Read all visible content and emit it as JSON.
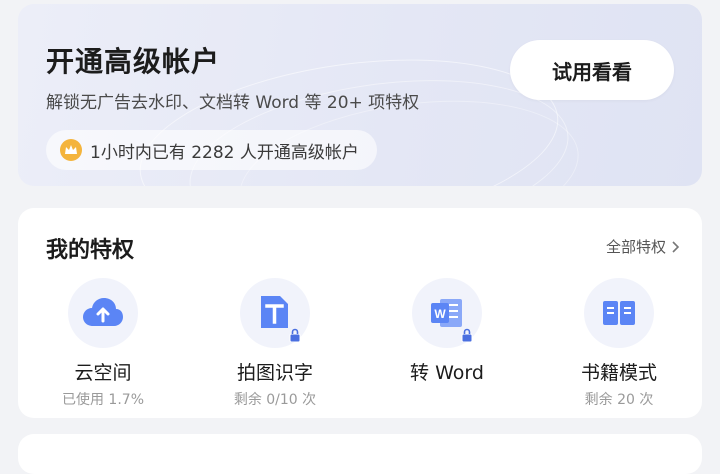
{
  "banner": {
    "title": "开通高级帐户",
    "subtitle": "解锁无广告去水印、文档转 Word 等 20+ 项特权",
    "button_label": "试用看看",
    "stat_text": "1小时内已有 2282 人开通高级帐户",
    "crown_icon": "crown-icon"
  },
  "privileges": {
    "title": "我的特权",
    "all_link": "全部特权",
    "items": [
      {
        "name": "云空间",
        "sub": "已使用 1.7%",
        "icon": "cloud-upload-icon",
        "locked": false
      },
      {
        "name": "拍图识字",
        "sub": "剩余 0/10 次",
        "icon": "text-recognition-icon",
        "locked": true
      },
      {
        "name": "转 Word",
        "sub": "",
        "icon": "word-icon",
        "locked": true
      },
      {
        "name": "书籍模式",
        "sub": "剩余 20 次",
        "icon": "book-mode-icon",
        "locked": false
      }
    ]
  },
  "colors": {
    "accent": "#4f7cf6",
    "banner_bg": "#e4e7f5",
    "crown": "#f4b43c"
  }
}
